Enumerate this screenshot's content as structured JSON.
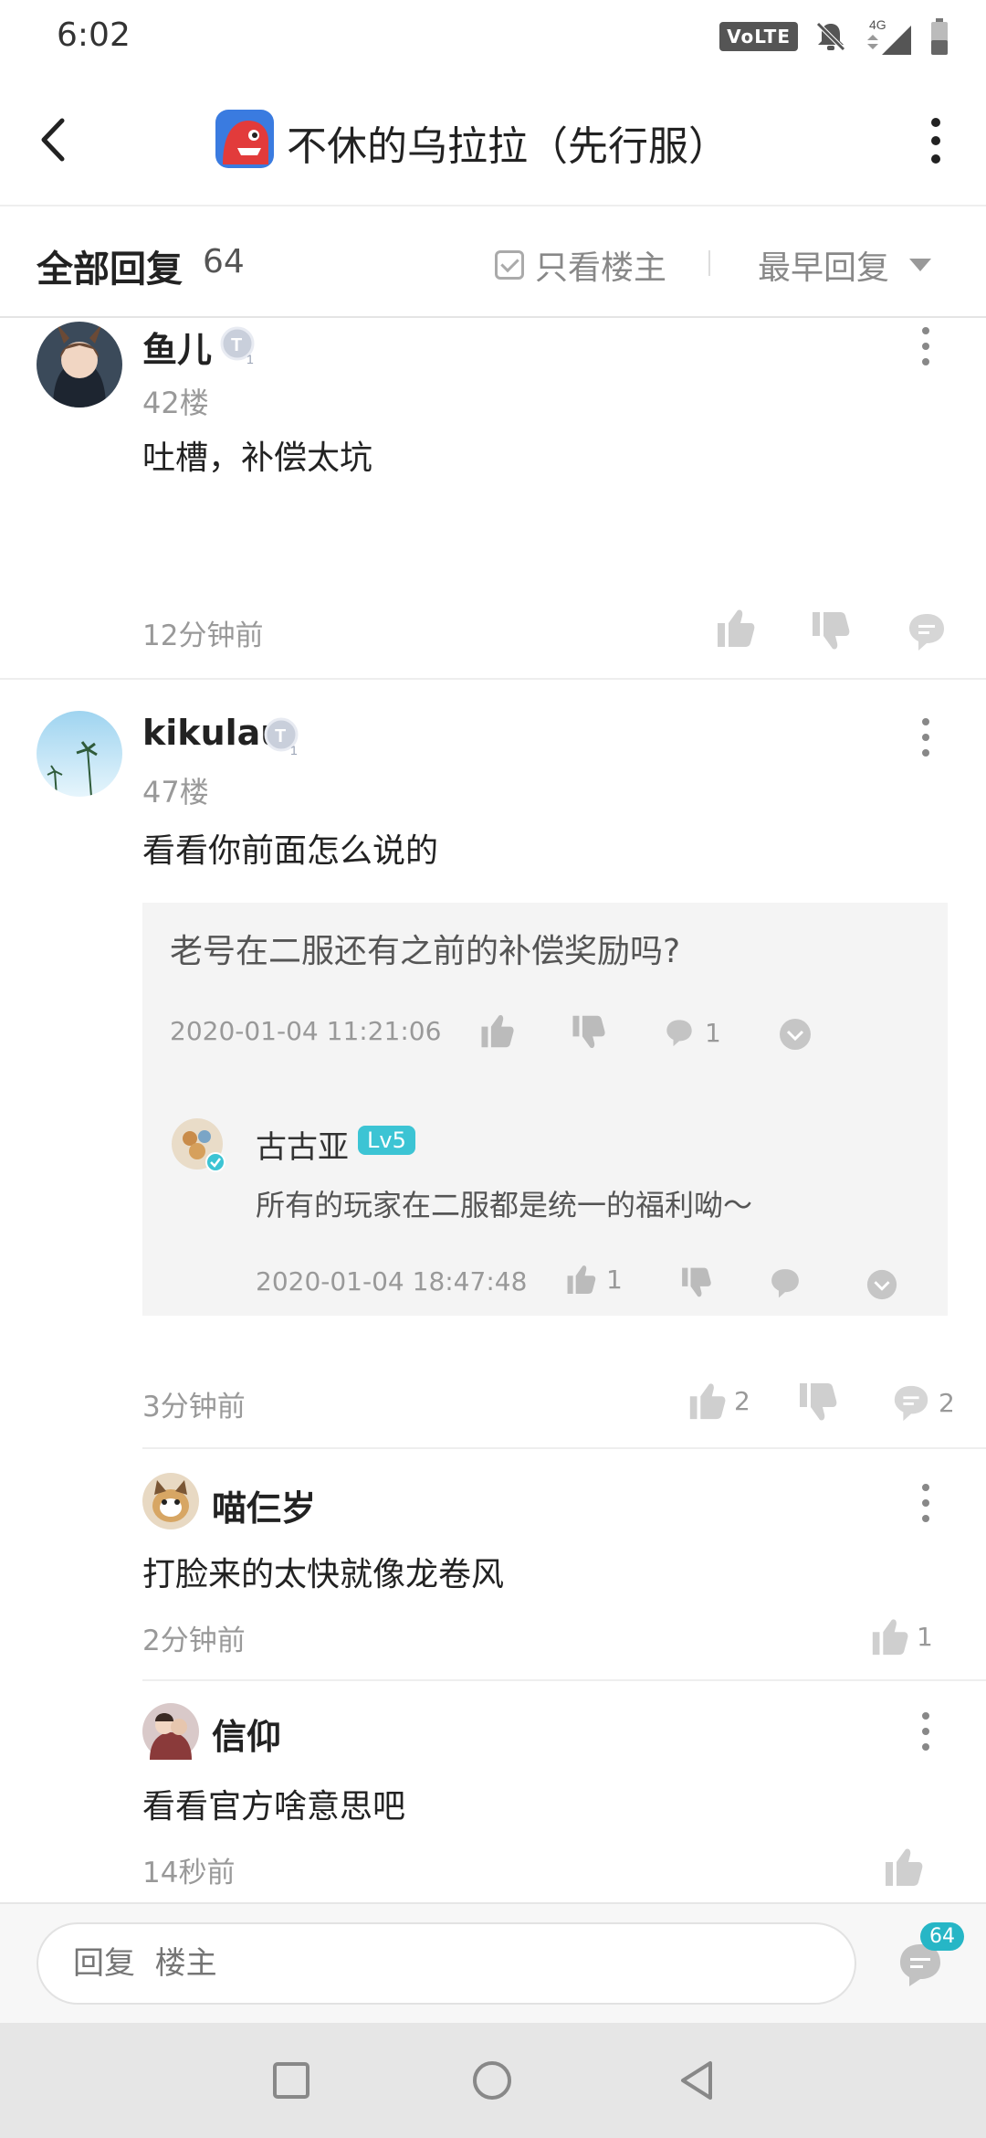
{
  "status_bar": {
    "time": "6:02",
    "volte_label": "VoLTE",
    "network_label": "4G",
    "icons": [
      "volte-icon",
      "bell-muted-icon",
      "signal-icon",
      "battery-icon"
    ]
  },
  "header": {
    "back_icon": "chevron-left-icon",
    "title": "不休的乌拉拉（先行服）",
    "more_icon": "vertical-dots-icon"
  },
  "filter": {
    "all_replies_label": "全部回复",
    "count": "64",
    "only_owner_label": "只看楼主",
    "sort_label": "最早回复"
  },
  "comments": [
    {
      "username": "鱼儿",
      "floor": "42楼",
      "text": "吐槽，补偿太坑",
      "time": "12分钟前"
    },
    {
      "username": "kikulau",
      "floor": "47楼",
      "text": "看看你前面怎么说的",
      "quote": {
        "question": "老号在二服还有之前的补偿奖励吗?",
        "date": "2020-01-04 11:21:06",
        "comment_count": "1",
        "official_name": "古古亚",
        "level": "Lv5",
        "answer": "所有的玩家在二服都是统一的福利呦～",
        "answer_date": "2020-01-04 18:47:48",
        "answer_likes": "1"
      },
      "time": "3分钟前",
      "likes": "2",
      "replies": "2"
    }
  ],
  "sub_replies": [
    {
      "username": "喵仨岁",
      "text": "打脸来的太快就像龙卷风",
      "time": "2分钟前",
      "likes": "1"
    },
    {
      "username": "信仰",
      "text": "看看官方啥意思吧",
      "time": "14秒前"
    }
  ],
  "reply_bar": {
    "placeholder": "回复  楼主",
    "badge_count": "64"
  },
  "colors": {
    "accent": "#26b6c6",
    "text_primary": "#222222",
    "text_secondary": "#999999",
    "quote_bg": "#f4f4f4"
  }
}
